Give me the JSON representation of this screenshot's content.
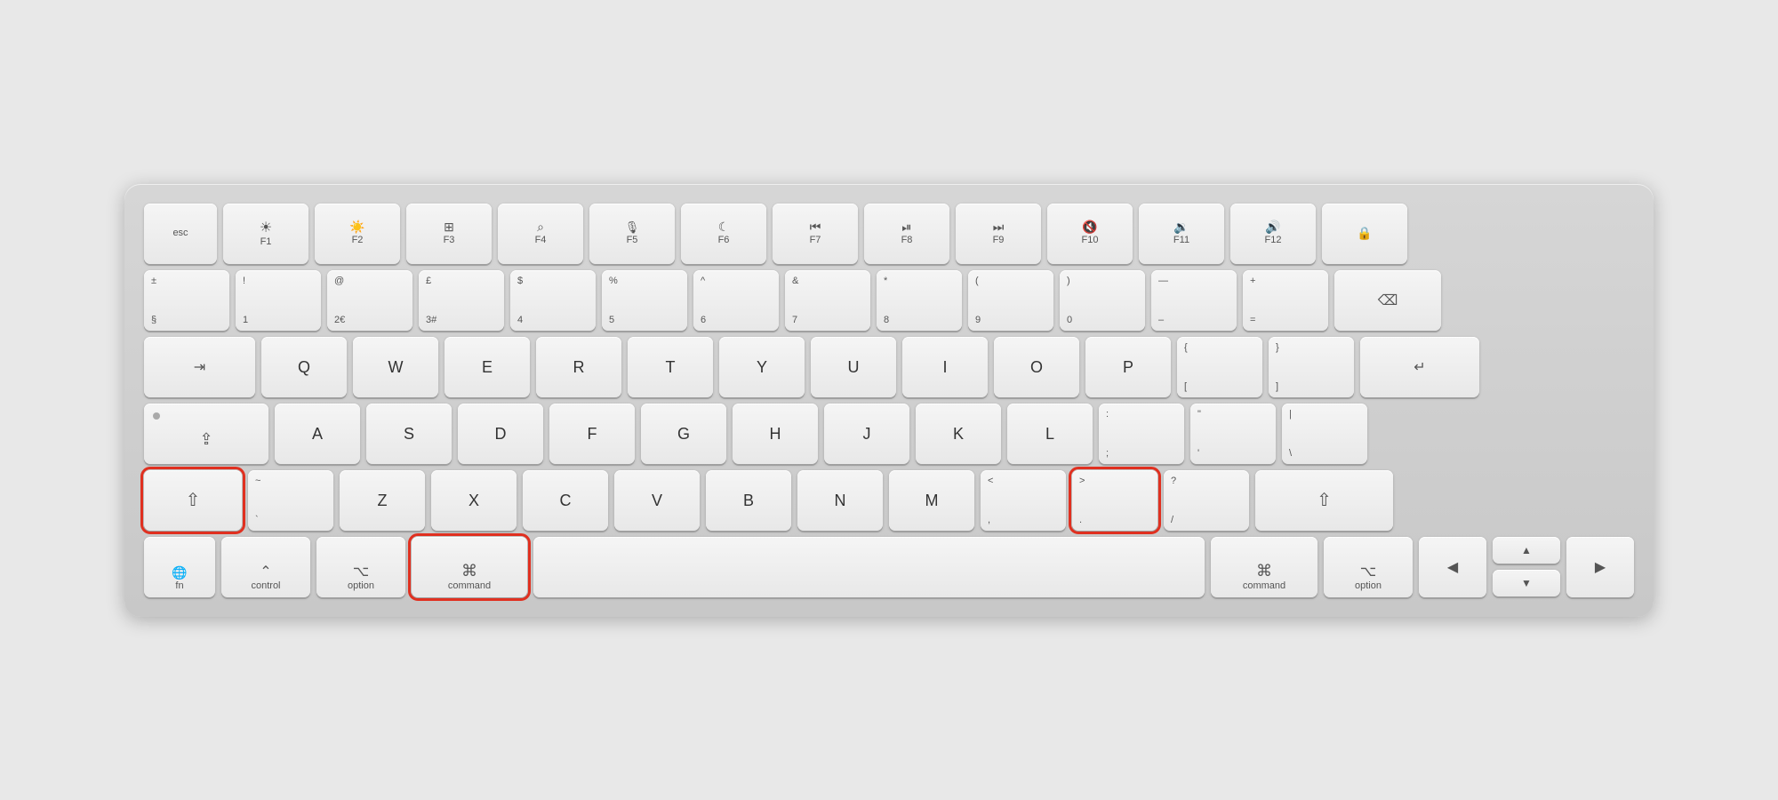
{
  "keyboard": {
    "rows": {
      "row0": {
        "keys": [
          {
            "id": "esc",
            "label": "esc",
            "width": "esc"
          },
          {
            "id": "f1",
            "icon": "☀",
            "sublabel": "F1",
            "width": "fn"
          },
          {
            "id": "f2",
            "icon": "✦",
            "sublabel": "F2",
            "width": "fn"
          },
          {
            "id": "f3",
            "icon": "⊞",
            "sublabel": "F3",
            "width": "fn"
          },
          {
            "id": "f4",
            "icon": "⌕",
            "sublabel": "F4",
            "width": "fn"
          },
          {
            "id": "f5",
            "icon": "🎙",
            "sublabel": "F5",
            "width": "fn"
          },
          {
            "id": "f6",
            "icon": "☾",
            "sublabel": "F6",
            "width": "fn"
          },
          {
            "id": "f7",
            "icon": "«",
            "sublabel": "F7",
            "width": "fn"
          },
          {
            "id": "f8",
            "icon": "▶⏸",
            "sublabel": "F8",
            "width": "fn"
          },
          {
            "id": "f9",
            "icon": "»",
            "sublabel": "F9",
            "width": "fn"
          },
          {
            "id": "f10",
            "icon": "🔇",
            "sublabel": "F10",
            "width": "fn"
          },
          {
            "id": "f11",
            "icon": "🔉",
            "sublabel": "F11",
            "width": "fn"
          },
          {
            "id": "f12",
            "icon": "🔊",
            "sublabel": "F12",
            "width": "fn"
          },
          {
            "id": "lock",
            "icon": "🔒",
            "width": "fn"
          }
        ]
      },
      "row1": {
        "keys": [
          {
            "id": "section",
            "top": "±",
            "bottom": "§",
            "width": "std"
          },
          {
            "id": "1",
            "top": "!",
            "bottom": "1",
            "width": "std"
          },
          {
            "id": "2",
            "top": "@",
            "bottom": "2€",
            "width": "std"
          },
          {
            "id": "3",
            "top": "£",
            "bottom": "3#",
            "width": "std"
          },
          {
            "id": "4",
            "top": "$",
            "bottom": "4",
            "width": "std"
          },
          {
            "id": "5",
            "top": "%",
            "bottom": "5",
            "width": "std"
          },
          {
            "id": "6",
            "top": "^",
            "bottom": "6",
            "width": "std"
          },
          {
            "id": "7",
            "top": "&",
            "bottom": "7",
            "width": "std"
          },
          {
            "id": "8",
            "top": "*",
            "bottom": "8",
            "width": "std"
          },
          {
            "id": "9",
            "top": "(",
            "bottom": "9",
            "width": "std"
          },
          {
            "id": "0",
            "top": ")",
            "bottom": "0",
            "width": "std"
          },
          {
            "id": "minus",
            "top": "—",
            "bottom": "–",
            "width": "std"
          },
          {
            "id": "equals",
            "top": "+",
            "bottom": "=",
            "width": "std"
          },
          {
            "id": "backspace",
            "icon": "⌫",
            "width": "backspace"
          }
        ]
      },
      "row2": {
        "keys": [
          {
            "id": "tab",
            "icon": "⇥",
            "width": "tab"
          },
          {
            "id": "q",
            "label": "Q",
            "width": "std"
          },
          {
            "id": "w",
            "label": "W",
            "width": "std"
          },
          {
            "id": "e",
            "label": "E",
            "width": "std"
          },
          {
            "id": "r",
            "label": "R",
            "width": "std"
          },
          {
            "id": "t",
            "label": "T",
            "width": "std"
          },
          {
            "id": "y",
            "label": "Y",
            "width": "std"
          },
          {
            "id": "u",
            "label": "U",
            "width": "std"
          },
          {
            "id": "i",
            "label": "I",
            "width": "std"
          },
          {
            "id": "o",
            "label": "O",
            "width": "std"
          },
          {
            "id": "p",
            "label": "P",
            "width": "std"
          },
          {
            "id": "lbrace",
            "top": "{",
            "bottom": "[",
            "width": "std"
          },
          {
            "id": "rbrace",
            "top": "}",
            "bottom": "]",
            "width": "std"
          },
          {
            "id": "enter",
            "icon": "↵",
            "width": "enter"
          }
        ]
      },
      "row3": {
        "keys": [
          {
            "id": "caps",
            "icon": "•",
            "width": "caps"
          },
          {
            "id": "a",
            "label": "A",
            "width": "std"
          },
          {
            "id": "s",
            "label": "S",
            "width": "std"
          },
          {
            "id": "d",
            "label": "D",
            "width": "std"
          },
          {
            "id": "f",
            "label": "F",
            "width": "std"
          },
          {
            "id": "g",
            "label": "G",
            "width": "std"
          },
          {
            "id": "h",
            "label": "H",
            "width": "std"
          },
          {
            "id": "j",
            "label": "J",
            "width": "std"
          },
          {
            "id": "k",
            "label": "K",
            "width": "std"
          },
          {
            "id": "l",
            "label": "L",
            "width": "std"
          },
          {
            "id": "semicolon",
            "top": ":",
            "bottom": ";",
            "width": "std"
          },
          {
            "id": "quote",
            "top": "\"",
            "bottom": "'",
            "width": "std"
          },
          {
            "id": "backslash",
            "label": "|\\",
            "width": "std"
          }
        ]
      },
      "row4": {
        "keys": [
          {
            "id": "shift-l",
            "icon": "⇧",
            "width": "shift-l",
            "highlighted": true
          },
          {
            "id": "backtick",
            "top": "~",
            "bottom": "`",
            "width": "std"
          },
          {
            "id": "z",
            "label": "Z",
            "width": "std"
          },
          {
            "id": "x",
            "label": "X",
            "width": "std"
          },
          {
            "id": "c",
            "label": "C",
            "width": "std"
          },
          {
            "id": "v",
            "label": "V",
            "width": "std"
          },
          {
            "id": "b",
            "label": "B",
            "width": "std"
          },
          {
            "id": "n",
            "label": "N",
            "width": "std"
          },
          {
            "id": "m",
            "label": "M",
            "width": "std"
          },
          {
            "id": "comma",
            "top": "<",
            "bottom": ",",
            "width": "std"
          },
          {
            "id": "period",
            "top": ">",
            "bottom": ".",
            "width": "std",
            "highlighted": true
          },
          {
            "id": "slash",
            "top": "?",
            "bottom": "/",
            "width": "std"
          },
          {
            "id": "shift-r",
            "icon": "⇧",
            "width": "shift-r"
          }
        ]
      },
      "row5": {
        "keys": [
          {
            "id": "fn",
            "label": "fn",
            "icon": "🌐",
            "width": "fn-key"
          },
          {
            "id": "control",
            "icon": "⌃",
            "sublabel": "control",
            "width": "ctrl"
          },
          {
            "id": "option-l",
            "icon": "⌥",
            "sublabel": "option",
            "width": "opt"
          },
          {
            "id": "command-l",
            "icon": "⌘",
            "sublabel": "command",
            "width": "cmd-l",
            "highlighted": true
          },
          {
            "id": "space",
            "label": "",
            "width": "space"
          },
          {
            "id": "command-r",
            "icon": "⌘",
            "sublabel": "command",
            "width": "cmd-r"
          },
          {
            "id": "option-r",
            "icon": "⌥",
            "sublabel": "option",
            "width": "opt-r"
          },
          {
            "id": "arrow-left",
            "icon": "◀",
            "width": "arrow-side"
          },
          {
            "id": "arrows-ud",
            "type": "double",
            "up": "▲",
            "down": "▼",
            "width": "arrow-side"
          },
          {
            "id": "arrow-right",
            "icon": "▶",
            "width": "arrow-side"
          }
        ]
      }
    }
  }
}
